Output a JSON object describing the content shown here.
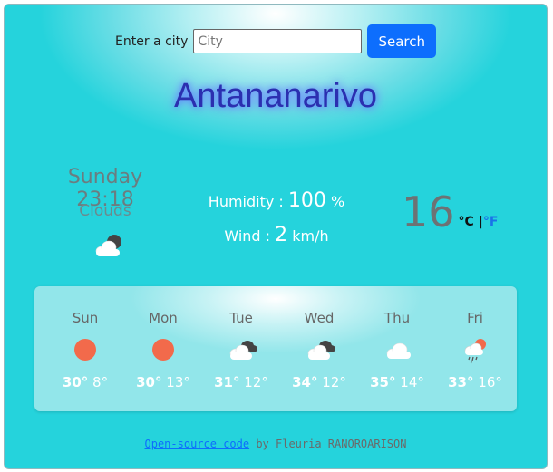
{
  "search": {
    "label": "Enter a city",
    "placeholder": "City",
    "value": "",
    "button_label": "Search"
  },
  "city": "Antananarivo",
  "current": {
    "datetime": "Sunday 23:18",
    "condition": "Clouds",
    "condition_icon": "cloud-night-icon",
    "humidity_label": "Humidity :",
    "humidity_value": "100",
    "humidity_unit": "%",
    "wind_label": "Wind :",
    "wind_value": "2",
    "wind_unit": "km/h",
    "temperature": "16",
    "unit_celsius": "°C",
    "unit_separator": "|",
    "unit_fahrenheit": "°F"
  },
  "forecast": [
    {
      "day": "Sun",
      "icon": "sun-icon",
      "high": "30°",
      "low": "8°"
    },
    {
      "day": "Mon",
      "icon": "sun-icon",
      "high": "30°",
      "low": "13°"
    },
    {
      "day": "Tue",
      "icon": "broken-clouds-icon",
      "high": "31°",
      "low": "12°"
    },
    {
      "day": "Wed",
      "icon": "broken-clouds-icon",
      "high": "34°",
      "low": "12°"
    },
    {
      "day": "Thu",
      "icon": "cloud-icon",
      "high": "35°",
      "low": "14°"
    },
    {
      "day": "Fri",
      "icon": "rain-sun-icon",
      "high": "33°",
      "low": "16°"
    }
  ],
  "footer": {
    "link_text": "Open-source code",
    "by_text": " by Fleuria RANOROARISON"
  },
  "colors": {
    "button": "#0d6efd",
    "sun": "#f26a4b",
    "background": "#25d3dc"
  }
}
